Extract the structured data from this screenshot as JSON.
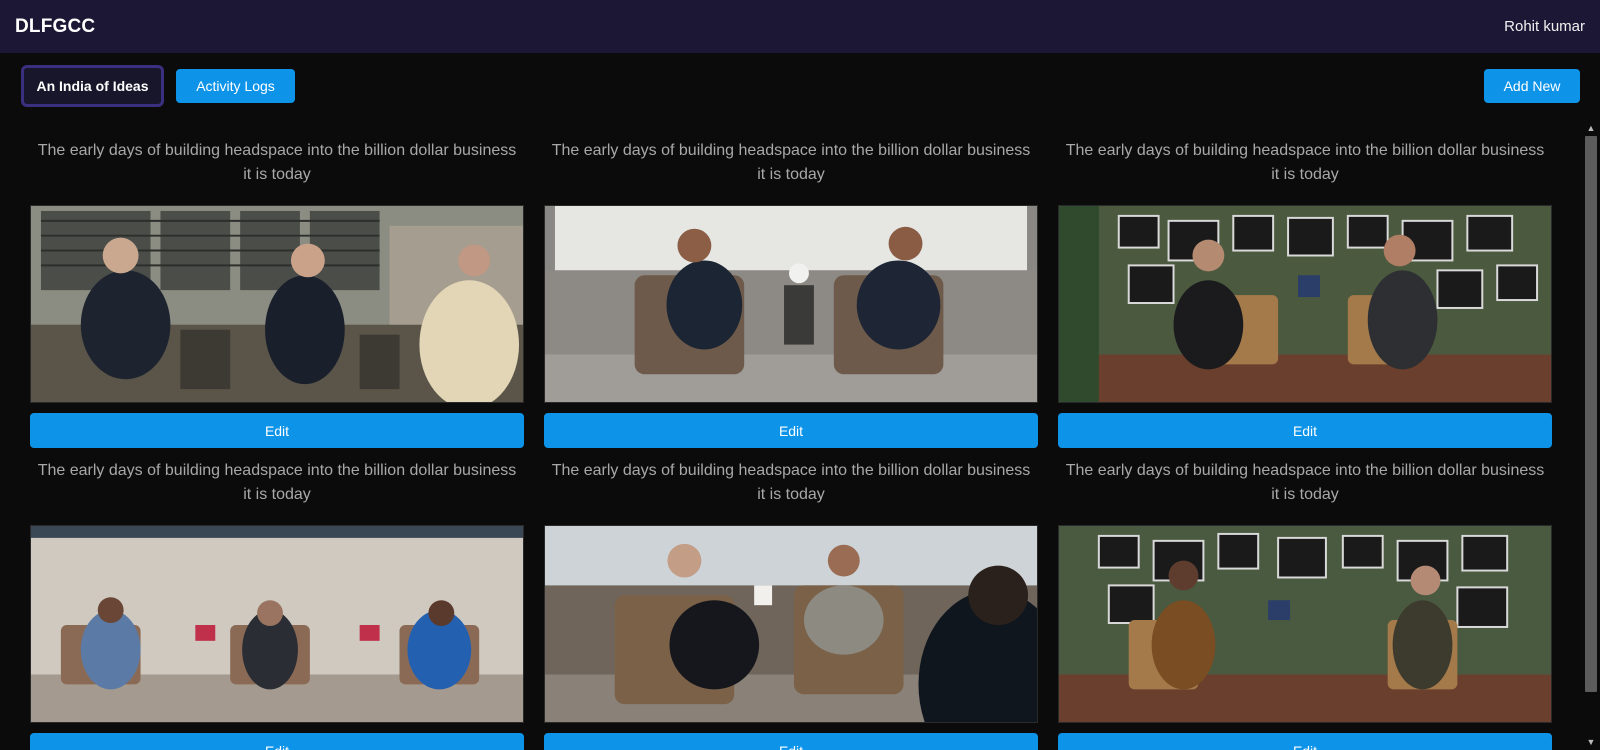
{
  "header": {
    "brand": "DLFGCC",
    "user_name": "Rohit kumar"
  },
  "toolbar": {
    "tabs": [
      {
        "label": "An India of Ideas",
        "active": true
      },
      {
        "label": "Activity Logs",
        "active": false
      }
    ],
    "add_new_label": "Add New"
  },
  "cards": [
    {
      "title": "The early days of building headspace into the billion dollar business it is today",
      "edit_label": "Edit",
      "photo": "panel-discussion-three-speakers"
    },
    {
      "title": "The early days of building headspace into the billion dollar business it is today",
      "edit_label": "Edit",
      "photo": "two-speakers-on-stage"
    },
    {
      "title": "The early days of building headspace into the billion dollar business it is today",
      "edit_label": "Edit",
      "photo": "two-speakers-gallery-wall"
    },
    {
      "title": "The early days of building headspace into the billion dollar business it is today",
      "edit_label": "Edit",
      "photo": "three-speakers-panel"
    },
    {
      "title": "The early days of building headspace into the billion dollar business it is today",
      "edit_label": "Edit",
      "photo": "two-speakers-with-audience"
    },
    {
      "title": "The early days of building headspace into the billion dollar business it is today",
      "edit_label": "Edit",
      "photo": "two-women-speakers-gallery-wall"
    }
  ],
  "colors": {
    "topbar": "#1b1735",
    "accent": "#0d93e8",
    "background": "#0b0b0c",
    "active_tab_border": "#3b2f80"
  }
}
